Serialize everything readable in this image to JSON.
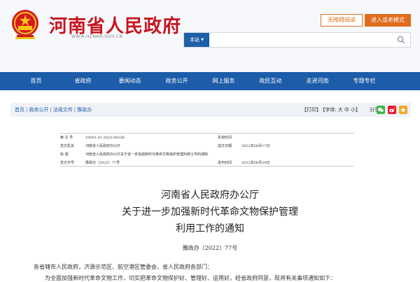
{
  "header": {
    "site_title": "河南省人民政府",
    "site_url": "WWW.HENAN.GOV.CN",
    "access_button": "无障碍阅读",
    "elder_button": "进入适老模式",
    "search": {
      "scope": "本站",
      "placeholder": ""
    }
  },
  "nav": {
    "items": [
      {
        "label": "首页"
      },
      {
        "label": "省政府"
      },
      {
        "label": "要闻动态"
      },
      {
        "label": "政务公开"
      },
      {
        "label": "网上服务"
      },
      {
        "label": "政民互动"
      },
      {
        "label": "走进河南"
      },
      {
        "label": "专题专栏"
      }
    ]
  },
  "breadcrumb": {
    "items": [
      "首页",
      "政务公开",
      "法规文件",
      "豫政办"
    ],
    "separator": "|"
  },
  "tools": {
    "print": "【打印】",
    "font_label": "【字体:",
    "font_large": "大",
    "font_medium": "中",
    "font_small": "小】",
    "share_label": "分享:"
  },
  "meta": {
    "rows": [
      {
        "label": "索 引 号",
        "value": "10001-01-2022-00256",
        "label2": "失效时间",
        "value2": ""
      },
      {
        "label": "发文机关",
        "value": "河南省人民政府办公厅",
        "label2": "成文日期",
        "value2": "2022年08月17日"
      },
      {
        "label": "标    题",
        "value": "河南省人民政府办公厅关于进一步加强新时代革命文物保护管理利用工作的通知",
        "label2": "",
        "value2": ""
      },
      {
        "label": "发文字号",
        "value": "豫政办〔2022〕77号",
        "label2": "发布时间",
        "value2": "2022年08月24日"
      }
    ]
  },
  "document": {
    "title_lines": [
      "河南省人民政府办公厅",
      "关于进一步加强新时代革命文物保护管理",
      "利用工作的通知"
    ],
    "doc_number": "豫政办〔2022〕77号",
    "salutation": "各省辖市人民政府，济源示范区、航空港区管委会，省人民政府各部门：",
    "first_line": "为全面加强新时代革命文物工作，切实把革命文物保护好、管理好、运用好，经省政府同意，现将有关事项通知如下："
  },
  "colors": {
    "brand_red": "#c8141e",
    "nav_blue": "#1c5ca8",
    "accent_orange": "#e06c1c"
  },
  "icons": {
    "emblem": "national-emblem-icon",
    "search": "search-icon",
    "share": [
      "wechat-icon",
      "weibo-icon",
      "qzone-icon"
    ]
  }
}
